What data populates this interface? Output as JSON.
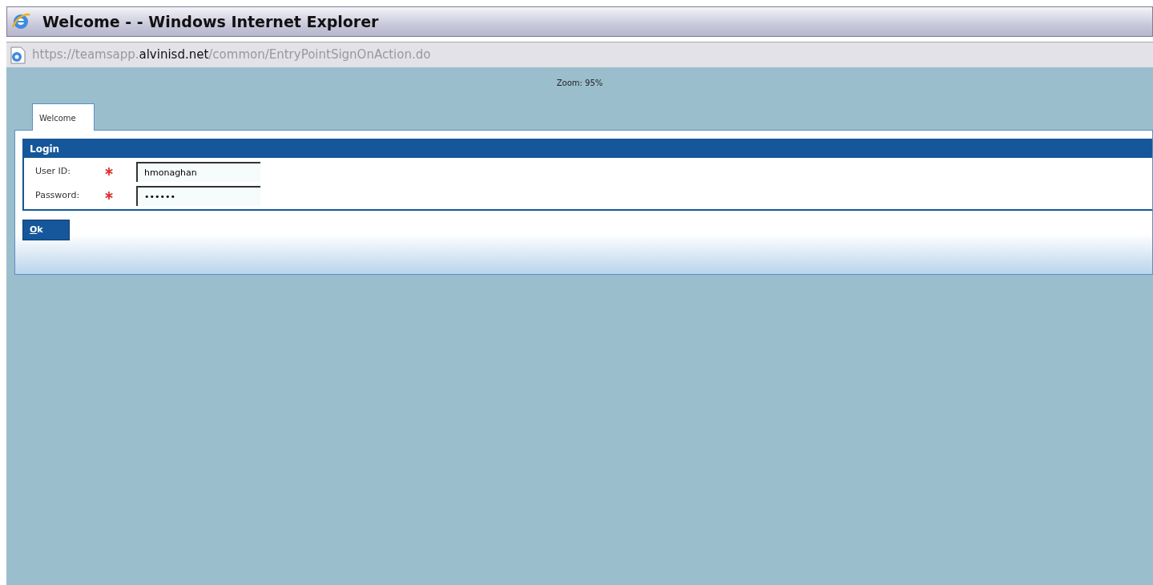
{
  "window": {
    "title": "Welcome - - Windows Internet Explorer"
  },
  "address_bar": {
    "prefix": "https://teamsapp.",
    "domain": "alvinisd.net",
    "path": "/common/EntryPointSignOnAction.do"
  },
  "zoom_label": "Zoom: 95%",
  "tabs": [
    {
      "label": "Welcome",
      "selected": true
    }
  ],
  "login": {
    "title": "Login",
    "fields": [
      {
        "label": "User ID:",
        "required": true,
        "value": "hmonaghan"
      },
      {
        "label": "Password:",
        "required": true,
        "value": "••••••"
      }
    ]
  },
  "buttons": [
    {
      "accesskey": "O",
      "label": "k"
    }
  ]
}
